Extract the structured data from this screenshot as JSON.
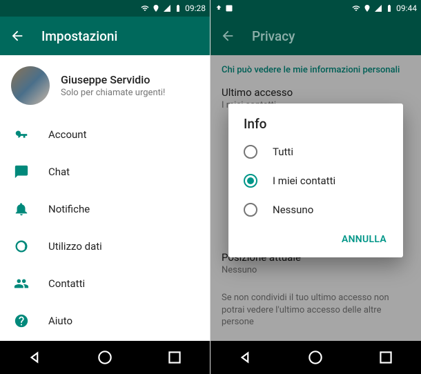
{
  "left": {
    "status": {
      "time": "09:28"
    },
    "header": {
      "title": "Impostazioni"
    },
    "profile": {
      "name": "Giuseppe Servidio",
      "status": "Solo per chiamate urgenti!"
    },
    "menu": {
      "account": "Account",
      "chat": "Chat",
      "notifications": "Notifiche",
      "data_usage": "Utilizzo dati",
      "contacts": "Contatti",
      "help": "Aiuto"
    }
  },
  "right": {
    "status": {
      "time": "09:44"
    },
    "header": {
      "title": "Privacy"
    },
    "section_title": "Chi può vedere le mie informazioni personali",
    "settings": {
      "last_seen": {
        "title": "Ultimo accesso",
        "value": "I miei contatti"
      },
      "live_location": {
        "title": "Posizione attuale",
        "value": "Nessuno"
      }
    },
    "note": "Se non condividi il tuo ultimo accesso non potrai vedere l'ultimo accesso delle altre persone",
    "dialog": {
      "title": "Info",
      "options": {
        "everyone": "Tutti",
        "my_contacts": "I miei contatti",
        "nobody": "Nessuno"
      },
      "selected": "my_contacts",
      "cancel": "ANNULLA"
    }
  }
}
